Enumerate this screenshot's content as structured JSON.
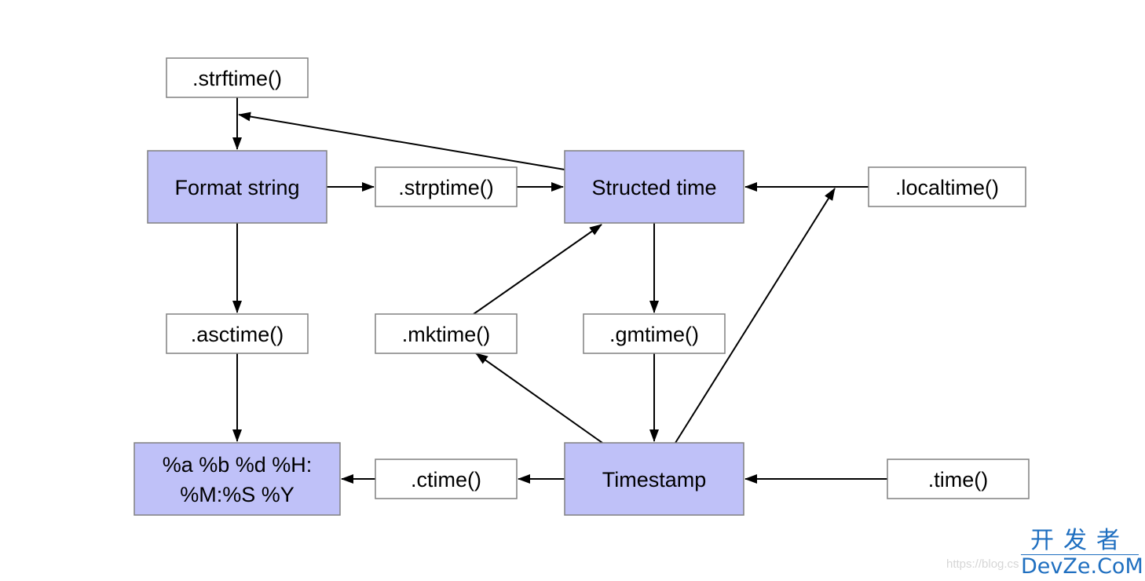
{
  "diagram": {
    "colors": {
      "primary_fill": "#bfc1f8",
      "secondary_fill": "#ffffff",
      "border": "#808080",
      "arrow": "#000000"
    },
    "nodes": [
      {
        "id": "strftime",
        "label": ".strftime()",
        "kind": "function"
      },
      {
        "id": "format_string",
        "label": "Format string",
        "kind": "type"
      },
      {
        "id": "strptime",
        "label": ".strptime()",
        "kind": "function"
      },
      {
        "id": "structed_time",
        "label": "Structed time",
        "kind": "type"
      },
      {
        "id": "localtime",
        "label": ".localtime()",
        "kind": "function"
      },
      {
        "id": "asctime",
        "label": ".asctime()",
        "kind": "function"
      },
      {
        "id": "mktime",
        "label": ".mktime()",
        "kind": "function"
      },
      {
        "id": "gmtime",
        "label": ".gmtime()",
        "kind": "function"
      },
      {
        "id": "fmt_output",
        "label": "%a %b %d %H:",
        "label2": "%M:%S %Y",
        "kind": "type"
      },
      {
        "id": "ctime",
        "label": ".ctime()",
        "kind": "function"
      },
      {
        "id": "timestamp",
        "label": "Timestamp",
        "kind": "type"
      },
      {
        "id": "time",
        "label": ".time()",
        "kind": "function"
      }
    ],
    "edges": [
      [
        "strftime",
        "format_string"
      ],
      [
        "structed_time",
        "strftime"
      ],
      [
        "format_string",
        "strptime"
      ],
      [
        "strptime",
        "structed_time"
      ],
      [
        "localtime",
        "structed_time"
      ],
      [
        "format_string",
        "asctime"
      ],
      [
        "asctime",
        "fmt_output"
      ],
      [
        "structed_time",
        "gmtime"
      ],
      [
        "gmtime",
        "timestamp"
      ],
      [
        "mktime",
        "structed_time"
      ],
      [
        "timestamp",
        "mktime"
      ],
      [
        "timestamp",
        "localtime"
      ],
      [
        "timestamp",
        "ctime"
      ],
      [
        "ctime",
        "fmt_output"
      ],
      [
        "time",
        "timestamp"
      ]
    ]
  },
  "watermark": {
    "url": "https://blog.cs",
    "logo_cn": "开发者",
    "logo_en": "DevZe.CoM"
  }
}
